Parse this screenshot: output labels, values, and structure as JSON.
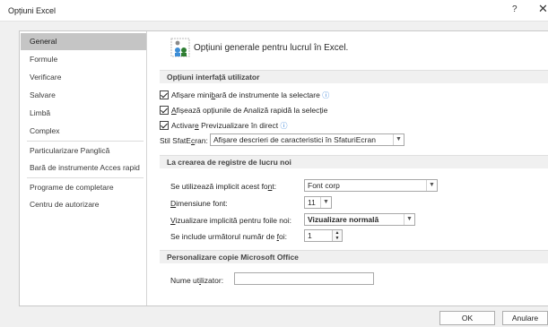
{
  "window": {
    "title": "Opțiuni Excel",
    "help": "?",
    "close": "✕"
  },
  "sidebar": {
    "items": [
      {
        "label": "General"
      },
      {
        "label": "Formule"
      },
      {
        "label": "Verificare"
      },
      {
        "label": "Salvare"
      },
      {
        "label": "Limbă"
      },
      {
        "label": "Complex"
      },
      {
        "label": "Particularizare Panglică"
      },
      {
        "label": "Bară de instrumente Acces rapid"
      },
      {
        "label": "Programe de completare"
      },
      {
        "label": "Centru de autorizare"
      }
    ],
    "selected": "General"
  },
  "header": {
    "text": "Opțiuni generale pentru lucrul în Excel."
  },
  "ui_options": {
    "title": "Opțiuni interfață utilizator",
    "mini_toolbar": {
      "pre": "Afișare mini",
      "u": "b",
      "post": "ară de instrumente la selectare",
      "checked": true
    },
    "quick_analysis": {
      "pre": "",
      "u": "A",
      "post": "fișează opțiunile de Analiză rapidă la selecție",
      "checked": true
    },
    "live_preview": {
      "pre": "Activar",
      "u": "e",
      "post": " Previzualizare în direct",
      "checked": true
    },
    "info_symbol": "ⓘ",
    "screentip": {
      "pre": "Stil SfatE",
      "u": "c",
      "post": "ran:",
      "value": "Afișare descrieri de caracteristici în SfaturiEcran"
    }
  },
  "workbook": {
    "title": "La crearea de registre de lucru noi",
    "font": {
      "pre": "Se utilizează implicit acest fo",
      "u": "n",
      "post": "t:",
      "value": "Font corp"
    },
    "font_size": {
      "pre": "",
      "u": "D",
      "post": "imensiune font:",
      "value": "11"
    },
    "default_view": {
      "pre": "",
      "u": "V",
      "post": "izualizare implicită pentru foile noi:",
      "value": "Vizualizare normală"
    },
    "sheets": {
      "pre": "Se include următorul număr de ",
      "u": "f",
      "post": "oi:",
      "value": "1"
    }
  },
  "personalize": {
    "title": "Personalizare copie Microsoft Office",
    "username": {
      "pre": "Nume ut",
      "u": "i",
      "post": "lizator:",
      "value": ""
    }
  },
  "buttons": {
    "ok": "OK",
    "cancel": "Anulare"
  },
  "icons": {
    "dropdown": "chevron-down-icon",
    "spinner": "spin-arrows-icon",
    "header": "options-gear-people-icon"
  }
}
